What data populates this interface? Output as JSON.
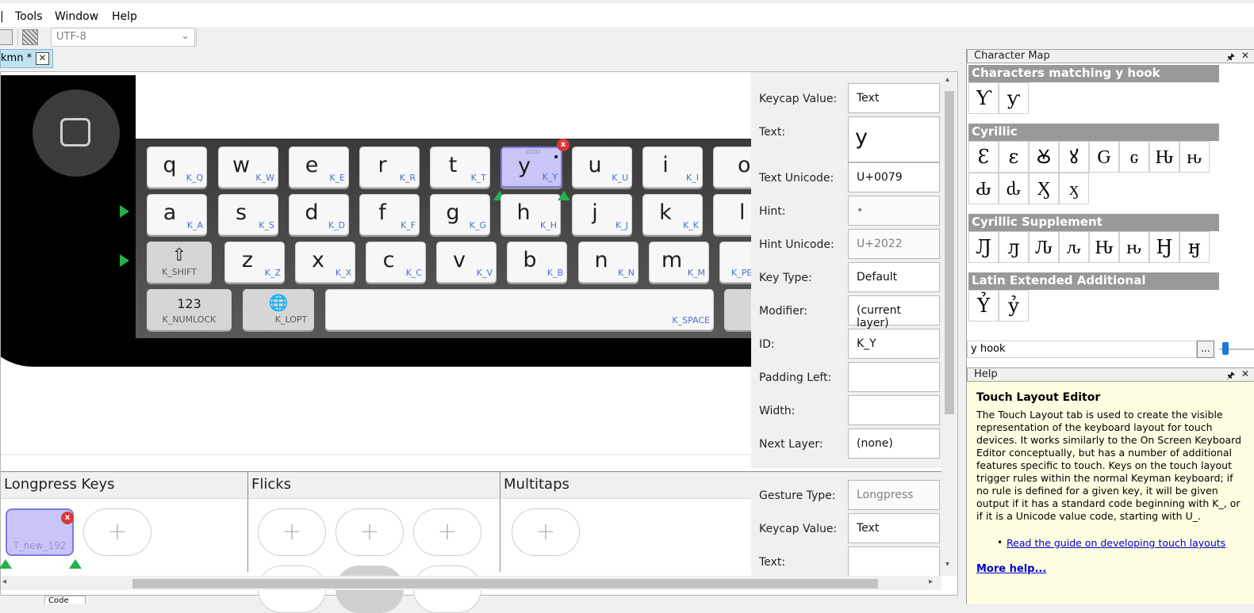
{
  "menu": {
    "tools": "Tools",
    "window": "Window",
    "help": "Help"
  },
  "toolbar": {
    "encoding": "UTF-8"
  },
  "file_tab": {
    "label": "kmn *"
  },
  "keyboard": {
    "row1": [
      {
        "cap": "q",
        "id": "K_Q"
      },
      {
        "cap": "w",
        "id": "K_W"
      },
      {
        "cap": "e",
        "id": "K_E"
      },
      {
        "cap": "r",
        "id": "K_R"
      },
      {
        "cap": "t",
        "id": "K_T"
      },
      {
        "cap": "y",
        "id": "K_Y"
      },
      {
        "cap": "u",
        "id": "K_U"
      },
      {
        "cap": "i",
        "id": "K_I"
      },
      {
        "cap": "o",
        "id": ""
      }
    ],
    "row2": [
      {
        "cap": "a",
        "id": "K_A"
      },
      {
        "cap": "s",
        "id": "K_S"
      },
      {
        "cap": "d",
        "id": "K_D"
      },
      {
        "cap": "f",
        "id": "K_F"
      },
      {
        "cap": "g",
        "id": "K_G"
      },
      {
        "cap": "h",
        "id": "K_H"
      },
      {
        "cap": "j",
        "id": "K_J"
      },
      {
        "cap": "k",
        "id": "K_K"
      },
      {
        "cap": "l",
        "id": ""
      }
    ],
    "row3": [
      {
        "cap": "⇧",
        "id": "K_SHIFT"
      },
      {
        "cap": "z",
        "id": "K_Z"
      },
      {
        "cap": "x",
        "id": "K_X"
      },
      {
        "cap": "c",
        "id": "K_C"
      },
      {
        "cap": "v",
        "id": "K_V"
      },
      {
        "cap": "b",
        "id": "K_B"
      },
      {
        "cap": "n",
        "id": "K_N"
      },
      {
        "cap": "m",
        "id": "K_M"
      },
      {
        "cap": "",
        "id": "K_PE"
      }
    ],
    "row4": [
      {
        "cap": "123",
        "id": "K_NUMLOCK"
      },
      {
        "cap": "🌐",
        "id": "K_LOPT"
      },
      {
        "cap": "",
        "id": "K_SPACE"
      }
    ]
  },
  "properties": {
    "keycap_value": {
      "label": "Keycap Value:",
      "value": "Text"
    },
    "text": {
      "label": "Text:",
      "value": "y"
    },
    "text_unicode": {
      "label": "Text Unicode:",
      "value": "U+0079"
    },
    "hint": {
      "label": "Hint:",
      "value": "•"
    },
    "hint_unicode": {
      "label": "Hint Unicode:",
      "value": "U+2022"
    },
    "key_type": {
      "label": "Key Type:",
      "value": "Default"
    },
    "modifier": {
      "label": "Modifier:",
      "value": "(current layer)"
    },
    "id": {
      "label": "ID:",
      "value": "K_Y"
    },
    "padding_left": {
      "label": "Padding Left:",
      "value": ""
    },
    "width": {
      "label": "Width:",
      "value": ""
    },
    "next_layer": {
      "label": "Next Layer:",
      "value": "(none)"
    }
  },
  "gestures": {
    "longpress": "Longpress Keys",
    "flicks": "Flicks",
    "multitaps": "Multitaps",
    "longpress_key_id": "T_new_192",
    "add_symbol": "+",
    "gesture_type": {
      "label": "Gesture Type:",
      "value": "Longpress"
    },
    "keycap_value": {
      "label": "Keycap Value:",
      "value": "Text"
    },
    "text": {
      "label": "Text:",
      "value": ""
    }
  },
  "charmap": {
    "title": "Character Map",
    "groups": [
      {
        "name": "Characters matching y hook",
        "chars": [
          "Ƴ",
          "ƴ"
        ]
      },
      {
        "name": "Cyrillic",
        "chars": [
          "Ԑ",
          "ԑ",
          "Ꙋ",
          "ꙋ",
          "Ԍ",
          "ԍ",
          "Ԋ",
          "ԋ",
          "Ԃ",
          "ԃ",
          "Ӽ",
          "ӽ"
        ]
      },
      {
        "name": "Cyrillic Supplement",
        "chars": [
          "Ԓ",
          "ԓ",
          "Ԉ",
          "ԉ",
          "Ԋ",
          "ԋ",
          "Ӈ",
          "ӈ"
        ]
      },
      {
        "name": "Latin Extended Additional",
        "chars": [
          "Ỷ",
          "ỷ"
        ]
      }
    ],
    "search": "y hook",
    "ellipsis": "..."
  },
  "help": {
    "panel_title": "Help",
    "heading": "Touch Layout Editor",
    "body": "The Touch Layout tab is used to create the visible representation of the keyboard layout for touch devices. It works similarly to the On Screen Keyboard Editor conceptually, but has a number of additional features specific to touch. Keys on the touch layout trigger rules within the normal Keyman keyboard; if no rule is defined for a given key, it will be given output if it has a standard code beginning with K_, or if it is a Unicode value code, starting with U_.",
    "link": "Read the guide on developing touch layouts",
    "more": "More help..."
  },
  "status_tab": "Code"
}
